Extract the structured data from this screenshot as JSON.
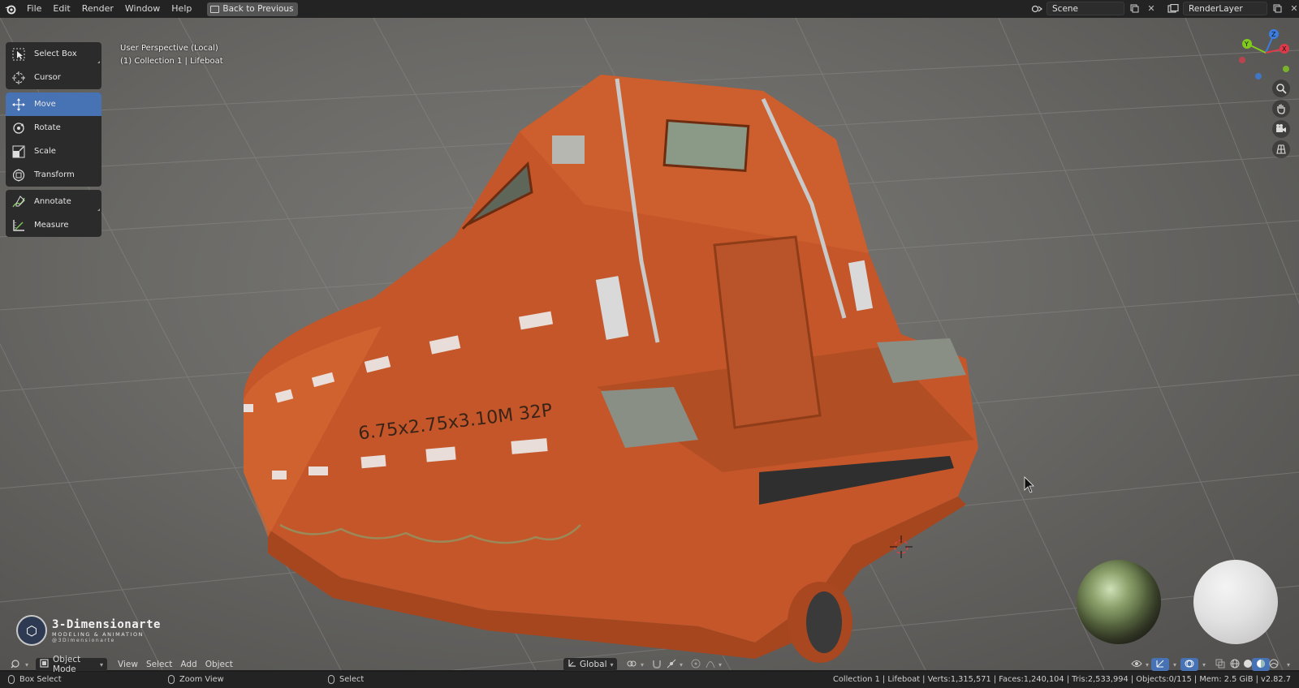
{
  "topbar": {
    "menu": [
      "File",
      "Edit",
      "Render",
      "Window",
      "Help"
    ],
    "back_button": "Back to Previous",
    "scene_name": "Scene",
    "view_layer": "RenderLayer"
  },
  "viewport": {
    "perspective_label": "User Perspective (Local)",
    "collection_label": "(1) Collection 1 | Lifeboat",
    "hull_text": "6.75x2.75x3.10M 32P"
  },
  "toolbar": {
    "group1": [
      {
        "label": "Select Box",
        "icon": "select-box-icon"
      },
      {
        "label": "Cursor",
        "icon": "cursor-icon"
      }
    ],
    "group2": [
      {
        "label": "Move",
        "icon": "move-icon",
        "active": true
      },
      {
        "label": "Rotate",
        "icon": "rotate-icon"
      },
      {
        "label": "Scale",
        "icon": "scale-icon"
      },
      {
        "label": "Transform",
        "icon": "transform-icon"
      }
    ],
    "group3": [
      {
        "label": "Annotate",
        "icon": "annotate-icon"
      },
      {
        "label": "Measure",
        "icon": "measure-icon"
      }
    ]
  },
  "gizmo": {
    "axes": [
      "Y",
      "Z",
      "X"
    ],
    "colors": {
      "x": "#e03a4a",
      "y": "#82c91e",
      "z": "#3b7de0"
    }
  },
  "watermark": {
    "title": "3-Dimensionarte",
    "subtitle": "MODELING & ANIMATION",
    "handle": "@3Dimensionarte"
  },
  "header": {
    "mode": "Object Mode",
    "menus": [
      "View",
      "Select",
      "Add",
      "Object"
    ],
    "orientation": "Global"
  },
  "statusbar": {
    "left_action": "Box Select",
    "middle_action": "Zoom View",
    "right_action": "Select",
    "stats": "Collection 1 | Lifeboat | Verts:1,315,571 | Faces:1,240,104 | Tris:2,533,994 | Objects:0/115 | Mem: 2.5 GiB | v2.82.7"
  },
  "colors": {
    "accent": "#4772b3",
    "hull": "#c85a2a",
    "viewport_bg": "#6a6966"
  }
}
